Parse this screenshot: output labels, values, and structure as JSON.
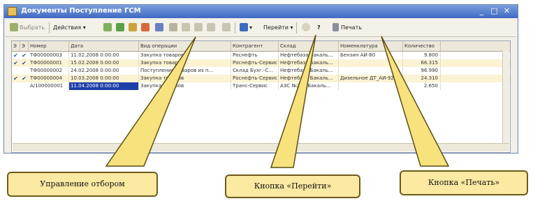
{
  "window": {
    "title": "Документы Поступление ГСМ"
  },
  "toolbar": {
    "select_label": "Выбрать",
    "actions_label": "Действия",
    "goto_label": "Перейти",
    "help_label": "?",
    "print_label": "Печать"
  },
  "table": {
    "columns": [
      "Э",
      "Э",
      "Номер",
      "Дата",
      "Вид операции",
      "Контрагент",
      "Склад",
      "Номенклатура",
      "Количество"
    ],
    "rows": [
      {
        "c1": "✔",
        "c2": "✔",
        "number": "ТФ00000003",
        "date": "11.02.2008 0:00:00",
        "op": "Закупка товаров",
        "agent": "Роснефть",
        "wh": "Нефтебаза Бакаль...",
        "item": "Бензин АИ-80",
        "qty": "9.800"
      },
      {
        "c1": "✔",
        "c2": "✔",
        "number": "ТФ00000001",
        "date": "15.02.2008 0:00:00",
        "op": "Закупка товаров",
        "agent": "Роснефть-Сервис",
        "wh": "Нефтебаза Бакаль...",
        "item": "",
        "qty": "66.315"
      },
      {
        "c1": "",
        "c2": "",
        "number": "ТФ00000002",
        "date": "24.02.2008 0:00:00",
        "op": "Поступление товаров из п...",
        "agent": "Склад Бухг.-С...",
        "wh": "Нефтебаза Бакаль...",
        "item": "",
        "qty": "96.990"
      },
      {
        "c1": "✔",
        "c2": "✔",
        "number": "ТФ00000004",
        "date": "10.03.2008 0:00:00",
        "op": "Закупка товаров",
        "agent": "Роснефть-Сервис",
        "wh": "Нефтебаза Бакаль...",
        "item": "Дизельное ДТ_АИ-92",
        "qty": "24.310"
      },
      {
        "c1": "",
        "c2": "",
        "number": "А/100000001",
        "date": "11.04.2008 0:00:00",
        "op": "Закупка товаров",
        "agent": "Транс-Сервис",
        "wh": "АЗС №2 п. Бакаль...",
        "item": "",
        "qty": "2.650"
      }
    ]
  },
  "callouts": {
    "filter": "Управление отбором",
    "goto": "Кнопка «Перейти»",
    "print": "Кнопка «Печать»"
  }
}
